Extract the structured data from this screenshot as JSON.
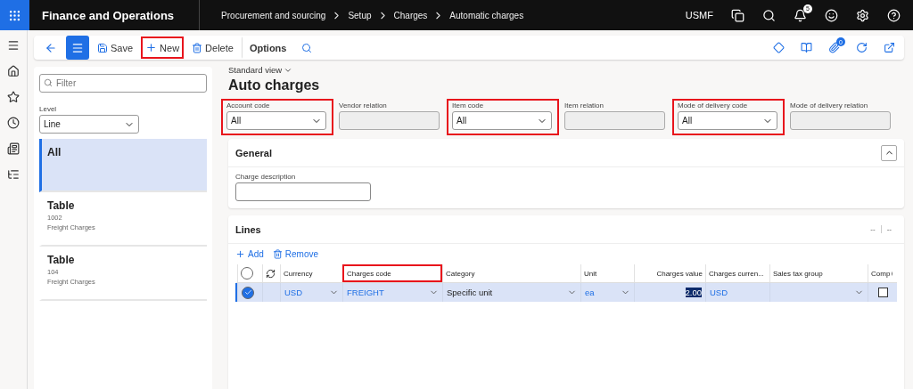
{
  "top_bar": {
    "app_title": "Finance and Operations",
    "breadcrumb": [
      "Procurement and sourcing",
      "Setup",
      "Charges",
      "Automatic charges"
    ],
    "company": "USMF",
    "notification_count": "5"
  },
  "toolbar": {
    "buttons": [
      {
        "kind": "save",
        "label": "Save",
        "highlighted": false
      },
      {
        "kind": "new",
        "label": "New",
        "highlighted": true
      },
      {
        "kind": "delete",
        "label": "Delete",
        "highlighted": false
      },
      {
        "kind": "options",
        "label": "Options",
        "highlighted": false
      }
    ],
    "attachment_count": "0"
  },
  "list_panel": {
    "filter_placeholder": "Filter",
    "level_label": "Level",
    "level_value": "Line",
    "items": [
      {
        "title": "All",
        "selected": true
      },
      {
        "title": "Table",
        "line_1": "1002",
        "line_2": "Freight Charges",
        "selected": false
      },
      {
        "title": "Table",
        "line_1": "104",
        "line_2": "Freight Charges",
        "selected": false
      }
    ]
  },
  "view_selector": "Standard view",
  "page_title": "Auto charges",
  "header_fields": [
    {
      "kind": "dropdown",
      "label": "Account code",
      "value": "All",
      "highlighted": true
    },
    {
      "kind": "disabled",
      "label": "Vendor relation",
      "highlighted": false
    },
    {
      "kind": "dropdown",
      "label": "Item code",
      "value": "All",
      "highlighted": true
    },
    {
      "kind": "disabled",
      "label": "Item relation",
      "highlighted": false
    },
    {
      "kind": "dropdown",
      "label": "Mode of delivery code",
      "value": "All",
      "highlighted": true
    },
    {
      "kind": "disabled",
      "label": "Mode of delivery relation",
      "highlighted": false
    }
  ],
  "general": {
    "title": "General",
    "expanded": true,
    "field_label": "Charge description"
  },
  "lines": {
    "title": "Lines",
    "all_selected": false,
    "summary": [
      "--",
      "--"
    ],
    "actions": [
      {
        "kind": "add",
        "label": "Add"
      },
      {
        "kind": "remove",
        "label": "Remove"
      }
    ],
    "columns": [
      {
        "label": "Currency",
        "highlighted": false
      },
      {
        "label": "Charges code",
        "highlighted": true
      },
      {
        "label": "Category",
        "highlighted": false
      },
      {
        "label": "Unit",
        "highlighted": false
      },
      {
        "label": "Charges value",
        "highlighted": false
      },
      {
        "label": "Charges curren...",
        "highlighted": false
      },
      {
        "label": "Sales tax group",
        "highlighted": false
      },
      {
        "label": "Comp",
        "highlighted": false
      }
    ],
    "rows": [
      {
        "selected": true,
        "cells": [
          {
            "kind": "link_dropdown",
            "value": "USD"
          },
          {
            "kind": "link_dropdown",
            "value": "FREIGHT"
          },
          {
            "kind": "dropdown",
            "value": "Specific unit"
          },
          {
            "kind": "link_dropdown",
            "value": "ea"
          },
          {
            "kind": "number",
            "value": "2.00"
          },
          {
            "kind": "link_text",
            "value": "USD"
          },
          {
            "kind": "dropdown"
          },
          {
            "kind": "checkbox",
            "checked": false
          }
        ]
      }
    ]
  }
}
